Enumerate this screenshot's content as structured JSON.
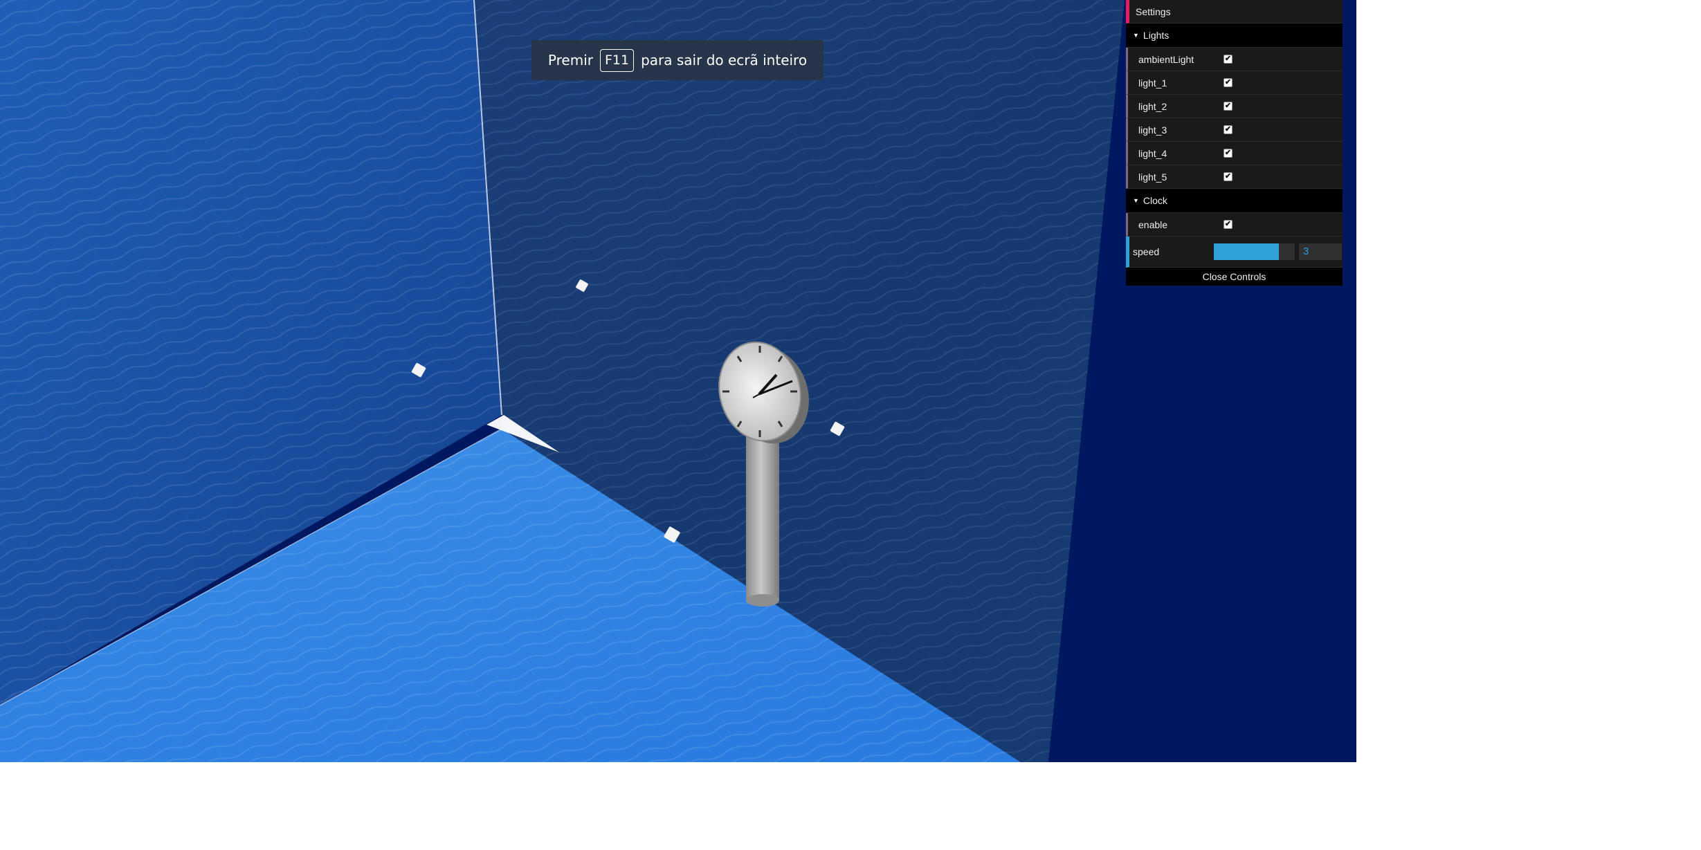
{
  "fullscreen_notice": {
    "prefix": "Premir",
    "key": "F11",
    "suffix": "para sair do ecrã inteiro"
  },
  "gui": {
    "settings_label": "Settings",
    "lights_folder": {
      "title": "Lights",
      "items": [
        {
          "label": "ambientLight",
          "checked": true
        },
        {
          "label": "light_1",
          "checked": true
        },
        {
          "label": "light_2",
          "checked": true
        },
        {
          "label": "light_3",
          "checked": true
        },
        {
          "label": "light_4",
          "checked": true
        },
        {
          "label": "light_5",
          "checked": true
        }
      ]
    },
    "clock_folder": {
      "title": "Clock",
      "enable_label": "enable",
      "enable_checked": true,
      "speed_label": "speed",
      "speed_value": "3",
      "speed_fraction": 0.8
    },
    "close_label": "Close Controls"
  },
  "colors": {
    "accent_settings": "#e61d5f",
    "accent_number": "#2fa1d6",
    "folder_bar": "#806787",
    "background": "#00185f"
  }
}
